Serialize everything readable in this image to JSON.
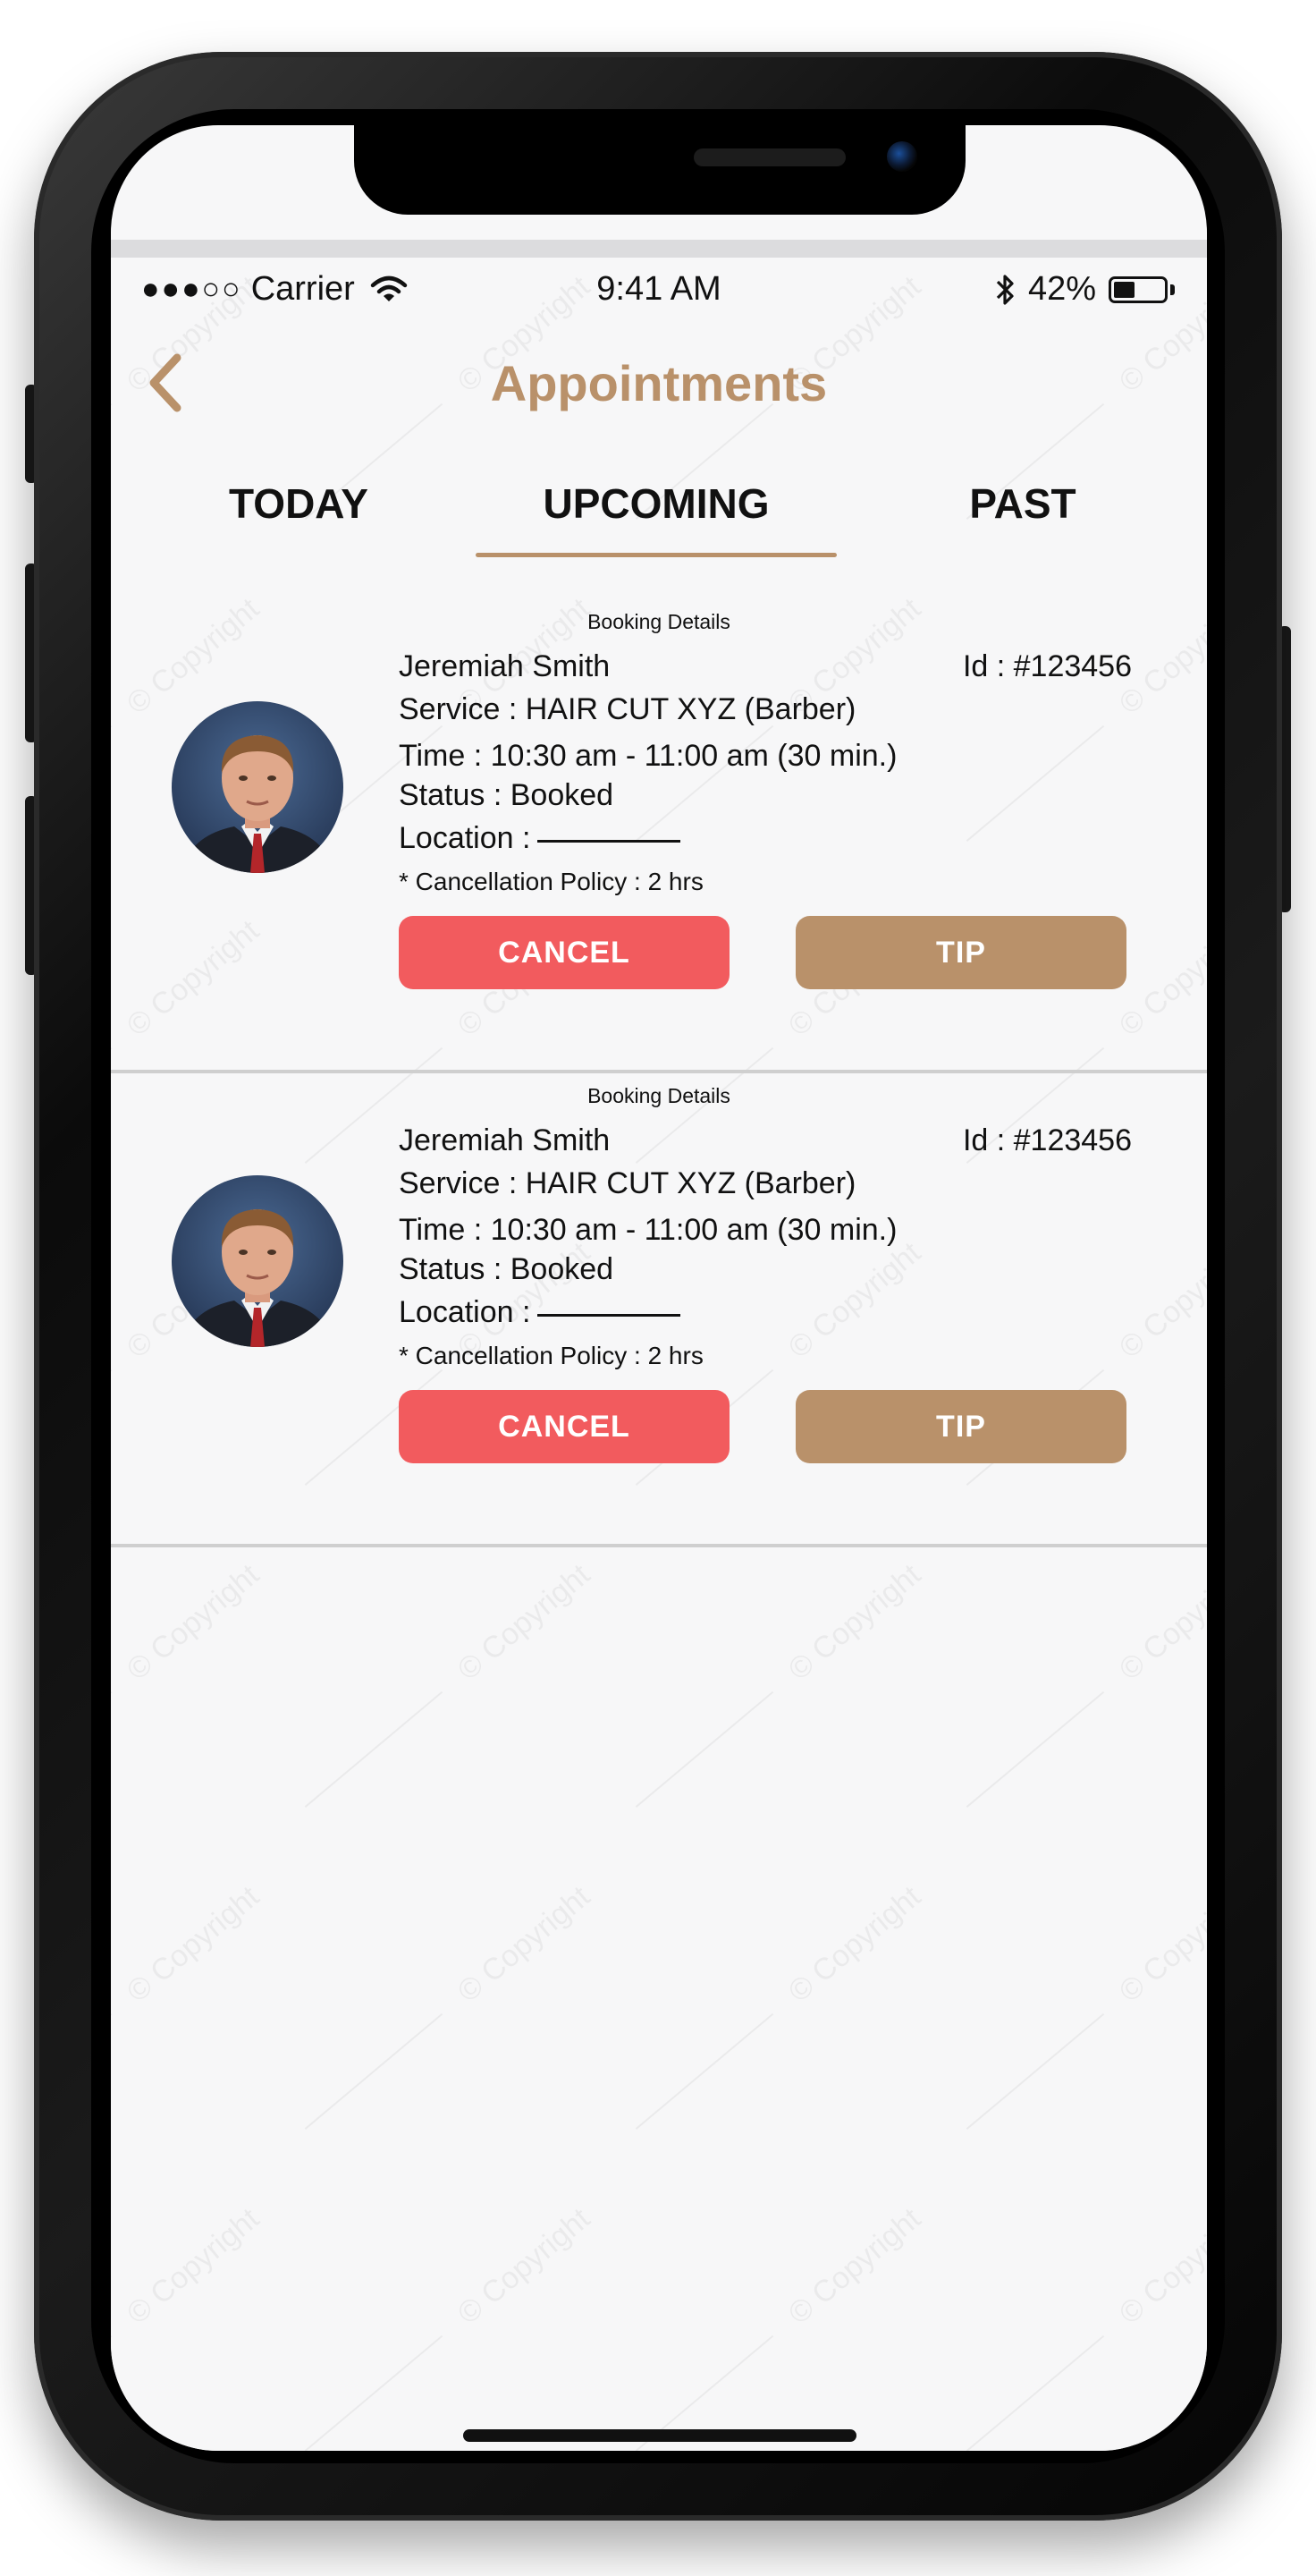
{
  "status_bar": {
    "signal": "●●●○○",
    "carrier": "Carrier",
    "time": "9:41 AM",
    "battery_percent": "42%",
    "battery_level": 0.42
  },
  "nav": {
    "title": "Appointments",
    "back_icon": "chevron-left-icon"
  },
  "tabs": [
    {
      "label": "TODAY",
      "selected": false
    },
    {
      "label": "UPCOMING",
      "selected": true
    },
    {
      "label": "PAST",
      "selected": false
    }
  ],
  "appointments": [
    {
      "heading": "Booking Details",
      "name": "Jeremiah Smith",
      "id": "Id : #123456",
      "service": "Service : HAIR CUT XYZ (Barber)",
      "time": "Time : 10:30 am - 11:00 am (30 min.)",
      "status": "Status : Booked",
      "location": "Location :",
      "policy": "* Cancellation Policy : 2 hrs",
      "cancel_label": "CANCEL",
      "tip_label": "TIP"
    },
    {
      "heading": "Booking Details",
      "name": "Jeremiah Smith",
      "id": "Id : #123456",
      "service": "Service : HAIR CUT XYZ (Barber)",
      "time": "Time : 10:30 am - 11:00 am (30 min.)",
      "status": "Status : Booked",
      "location": "Location :",
      "policy": "* Cancellation Policy : 2 hrs",
      "cancel_label": "CANCEL",
      "tip_label": "TIP"
    }
  ],
  "watermark_text": "© Copyright",
  "colors": {
    "accent": "#b9916a",
    "cancel": "#f25b5e",
    "tip": "#b9916a",
    "background": "#f7f7f8"
  }
}
